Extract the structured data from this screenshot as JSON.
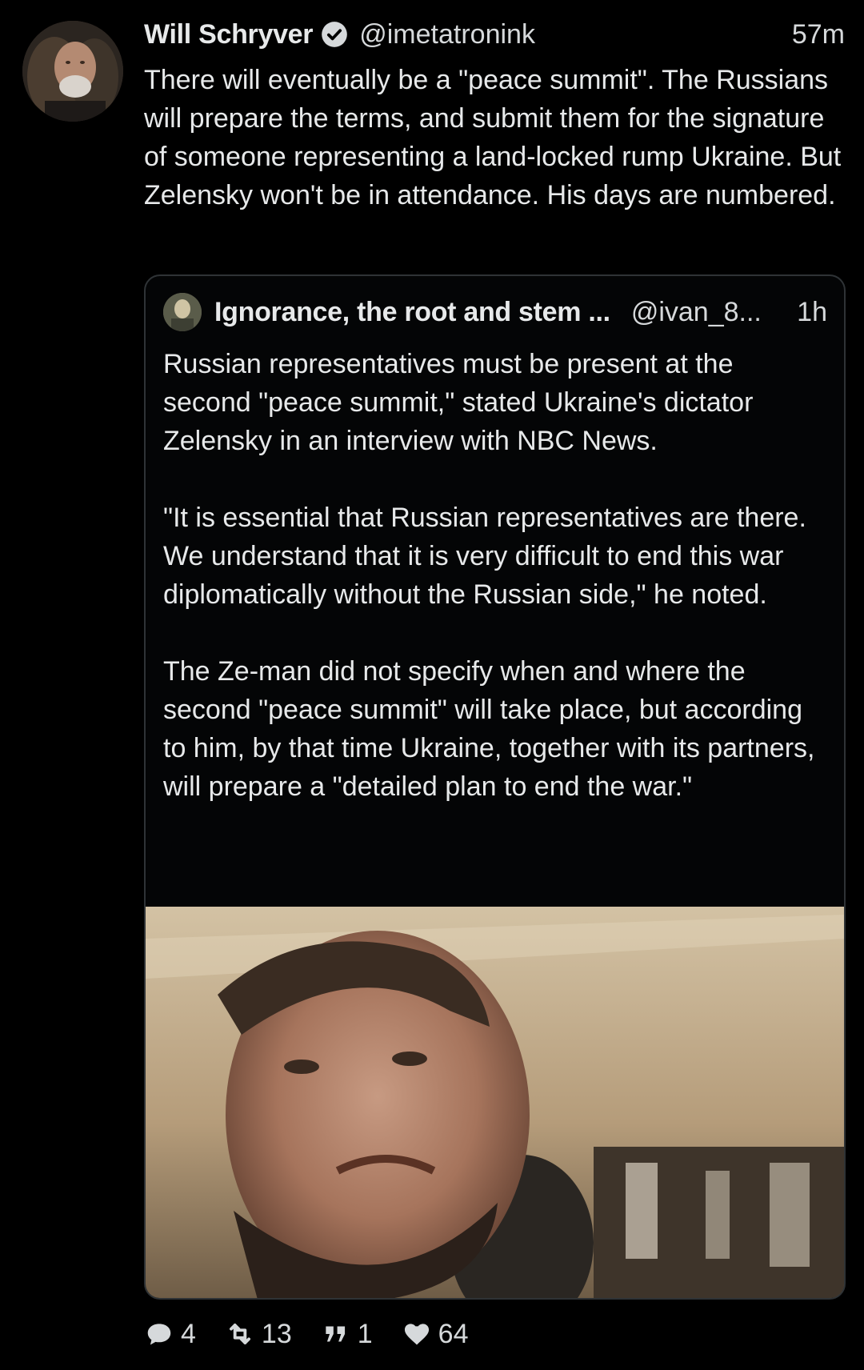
{
  "tweet": {
    "author_name": "Will Schryver",
    "handle": "@imetatronink",
    "time": "57m",
    "text": "There will eventually be a \"peace summit\". The Russians will prepare the terms, and submit them for the signature of someone representing a land-locked rump Ukraine. But Zelensky won't be in attendance. His days are numbered."
  },
  "quoted": {
    "author_name": "Ignorance, the root and stem ...",
    "handle": "@ivan_8...",
    "time": "1h",
    "paragraphs": [
      "Russian representatives must be present at the second \"peace summit,\" stated Ukraine's dictator Zelensky in an interview with NBC News.",
      "\"It is essential that Russian representatives are there. We understand that it is very difficult to end this war diplomatically without the Russian side,\" he noted.",
      "The Ze-man did not specify when and where the second \"peace summit\" will take place, but according to him, by that time Ukraine, together with its partners, will prepare a \"detailed plan to end the war.\""
    ]
  },
  "actions": {
    "replies": "4",
    "retweets": "13",
    "quotes": "1",
    "likes": "64"
  },
  "icons": {
    "verified": "verified-badge-icon",
    "reply": "reply-bubble-icon",
    "retweet": "retweet-icon",
    "quote": "quote-marks-icon",
    "like": "heart-icon"
  },
  "colors": {
    "background": "#000000",
    "text": "#e7e9ea",
    "secondary_text": "#d6d9db",
    "border": "#2f3336"
  }
}
